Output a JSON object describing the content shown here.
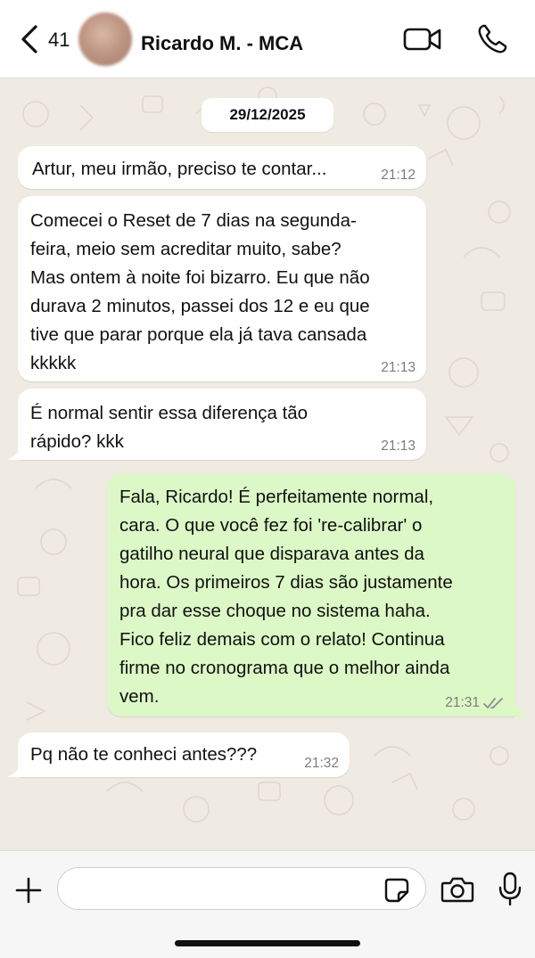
{
  "header": {
    "back_label": "Back",
    "unread_count": "41",
    "contact_name": "Ricardo M. - MCA"
  },
  "chat": {
    "date": "29/12/2025",
    "messages": [
      {
        "direction": "in",
        "text": "Artur, meu irmão, preciso te contar...",
        "time": "21:12"
      },
      {
        "direction": "in",
        "lines": [
          "Comecei o Reset de 7 dias na segunda-",
          "feira, meio sem acreditar muito, sabe?",
          "Mas ontem à noite foi bizarro. Eu que não",
          "durava 2 minutos, passei dos 12 e eu que",
          "tive que parar porque ela já tava cansada",
          "kkkkk"
        ],
        "time": "21:13"
      },
      {
        "direction": "in",
        "lines": [
          "É normal sentir essa diferença tão",
          "rápido? kkk"
        ],
        "time": "21:13"
      },
      {
        "direction": "out",
        "lines": [
          "Fala, Ricardo! É perfeitamente normal,",
          "cara. O que você fez foi 're-calibrar' o",
          "gatilho neural que disparava antes da",
          "hora. Os primeiros 7 dias são justamente",
          "pra dar esse choque no sistema haha.",
          "Fico feliz demais com o relato! Continua",
          "firme no cronograma que o melhor ainda",
          "vem."
        ],
        "time": "21:31",
        "status": "read"
      },
      {
        "direction": "in",
        "text": "Pq não te conheci antes???",
        "time": "21:32"
      }
    ]
  },
  "composer": {
    "placeholder": ""
  },
  "colors": {
    "incoming": "#ffffff",
    "outgoing": "#dcf8c6",
    "background": "#efeae2",
    "read_check": "#8c8c8c"
  },
  "icons": [
    "chevron-left-icon",
    "video-icon",
    "phone-icon",
    "plus-icon",
    "sticker-icon",
    "camera-icon",
    "microphone-icon",
    "double-check-icon"
  ]
}
